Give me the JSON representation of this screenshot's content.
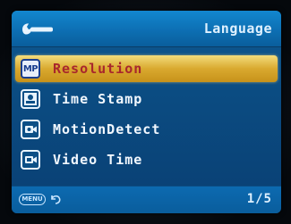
{
  "header": {
    "icon": "wrench-icon",
    "title": "Language"
  },
  "menu": {
    "selected_index": 0,
    "items": [
      {
        "label": "Resolution",
        "icon": "mp-resolution-icon"
      },
      {
        "label": "Time Stamp",
        "icon": "time-stamp-icon"
      },
      {
        "label": "MotionDetect",
        "icon": "motion-detect-icon"
      },
      {
        "label": "Video Time",
        "icon": "video-time-icon"
      }
    ]
  },
  "footer": {
    "menu_key_label": "MENU",
    "back_icon": "return-arrow-icon",
    "page_indicator": "1/5"
  },
  "colors": {
    "background": "#0b4c82",
    "header": "#0d6fb3",
    "selection": "#d9a92f",
    "selected_text": "#a8272c",
    "text": "#f2f8ff"
  }
}
